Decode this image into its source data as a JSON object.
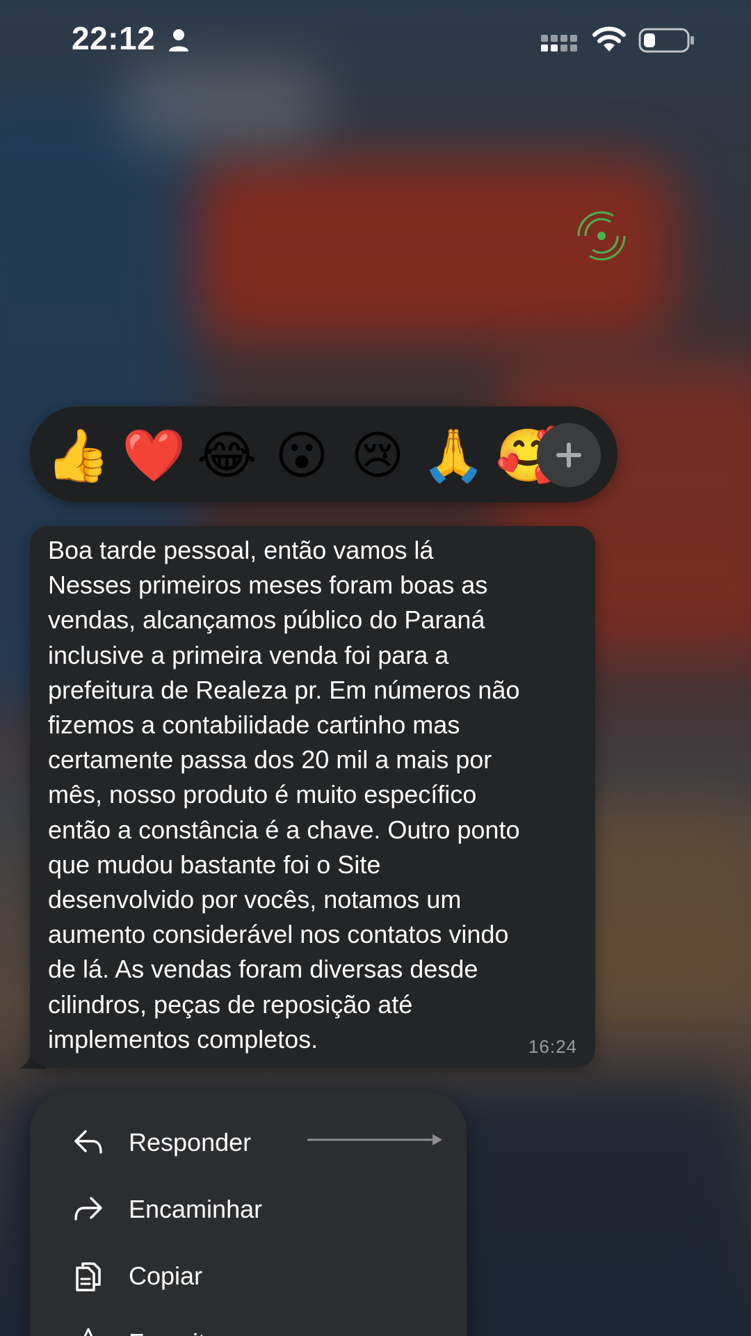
{
  "status_bar": {
    "time": "22:12"
  },
  "reactions": {
    "emojis": [
      "👍",
      "❤️",
      "😂",
      "😮",
      "😢",
      "🙏",
      "🥰"
    ],
    "more_label": "+"
  },
  "message": {
    "text": "Boa tarde pessoal, então vamos lá\nNesses primeiros meses foram boas as\nvendas, alcançamos público do Paraná\ninclusive a primeira venda foi para a\nprefeitura de Realeza pr. Em números não\nfizemos a contabilidade cartinho mas\ncertamente passa dos 20 mil a mais por\nmês, nosso produto é muito específico\nentão a constância é a chave. Outro ponto\nque mudou bastante foi o Site\ndesenvolvido por vocês, notamos um\naumento considerável nos contatos vindo\nde lá. As vendas foram diversas desde\ncilindros, peças de reposição até\nimplementos completos.",
    "time": "16:24"
  },
  "menu": {
    "items": [
      {
        "label": "Responder",
        "icon": "reply-icon"
      },
      {
        "label": "Encaminhar",
        "icon": "forward-icon"
      },
      {
        "label": "Copiar",
        "icon": "copy-icon"
      },
      {
        "label": "Favoritar",
        "icon": "star-icon"
      }
    ]
  },
  "colors": {
    "bubble": "#242526",
    "menu": "#2c2d2f",
    "reaction_bar": "#1f2021",
    "accent_green": "#4caf50"
  }
}
